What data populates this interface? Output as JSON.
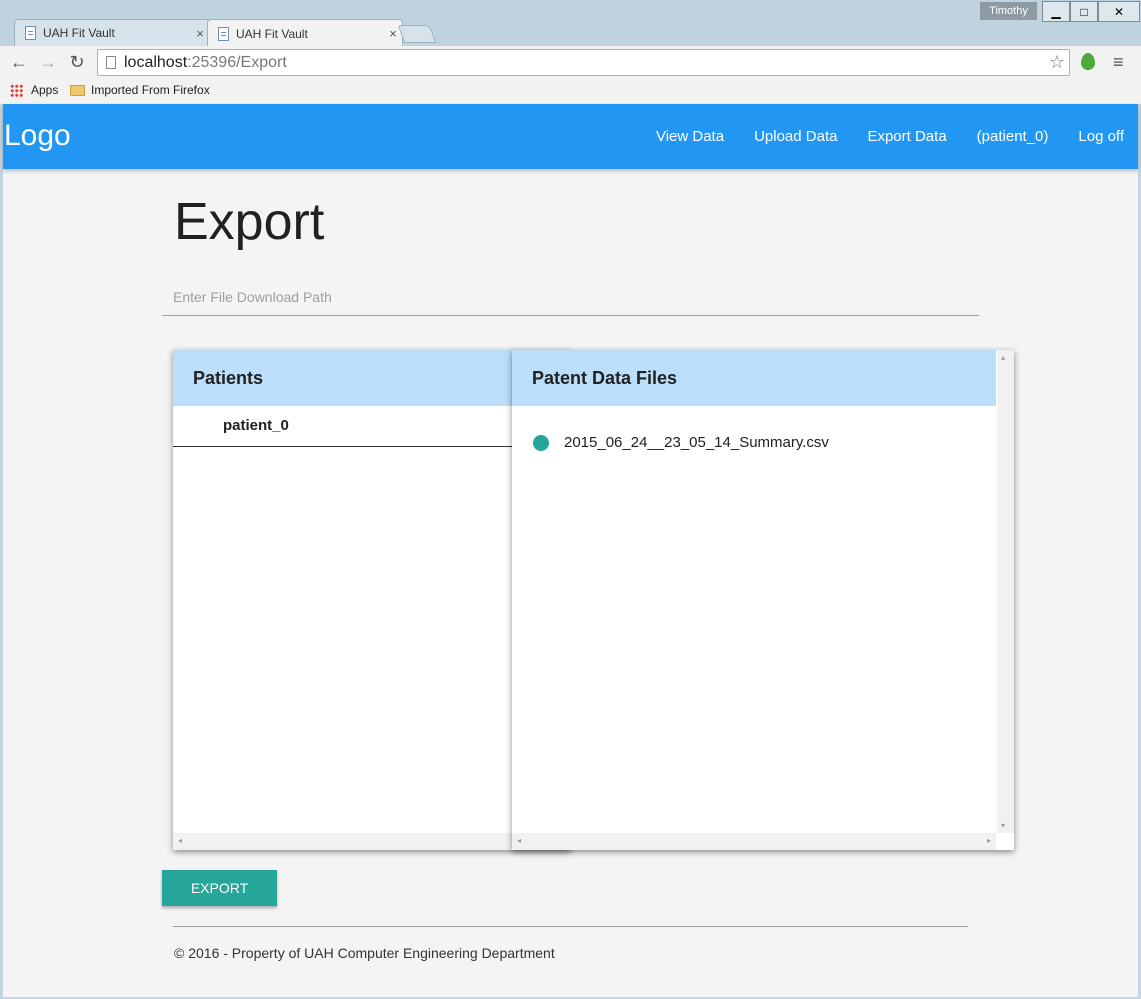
{
  "browser": {
    "tabs": [
      {
        "title": "UAH Fit Vault",
        "close": "×"
      },
      {
        "title": "UAH Fit Vault",
        "close": "×"
      }
    ],
    "user": "Timothy",
    "window_buttons": {
      "minimize": "▁",
      "maximize": "□",
      "close": "✕"
    },
    "nav": {
      "back": "←",
      "forward": "→",
      "reload": "↻"
    },
    "address": {
      "host": "localhost",
      "path": ":25396/Export"
    },
    "star": "☆",
    "menu": "≡",
    "bookmarks": {
      "apps": "Apps",
      "folder": "Imported From Firefox"
    }
  },
  "appbar": {
    "logo": "Logo",
    "links": [
      "View Data",
      "Upload Data",
      "Export Data",
      "(patient_0)",
      "Log off"
    ]
  },
  "main": {
    "title": "Export",
    "path_placeholder": "Enter File Download Path",
    "patients_header": "Patients",
    "patients": [
      "patient_0"
    ],
    "files_header": "Patent Data Files",
    "files": [
      "2015_06_24__23_05_14_Summary.csv"
    ],
    "export_label": "EXPORT",
    "scroll": {
      "left": "◂",
      "right": "▸",
      "up": "▴",
      "down": "▾"
    }
  },
  "footer": {
    "text": "© 2016 - Property of UAH Computer Engineering Department"
  },
  "colors": {
    "appbar": "#2196f3",
    "panel_header": "#bbdefb",
    "accent": "#26a69a"
  }
}
